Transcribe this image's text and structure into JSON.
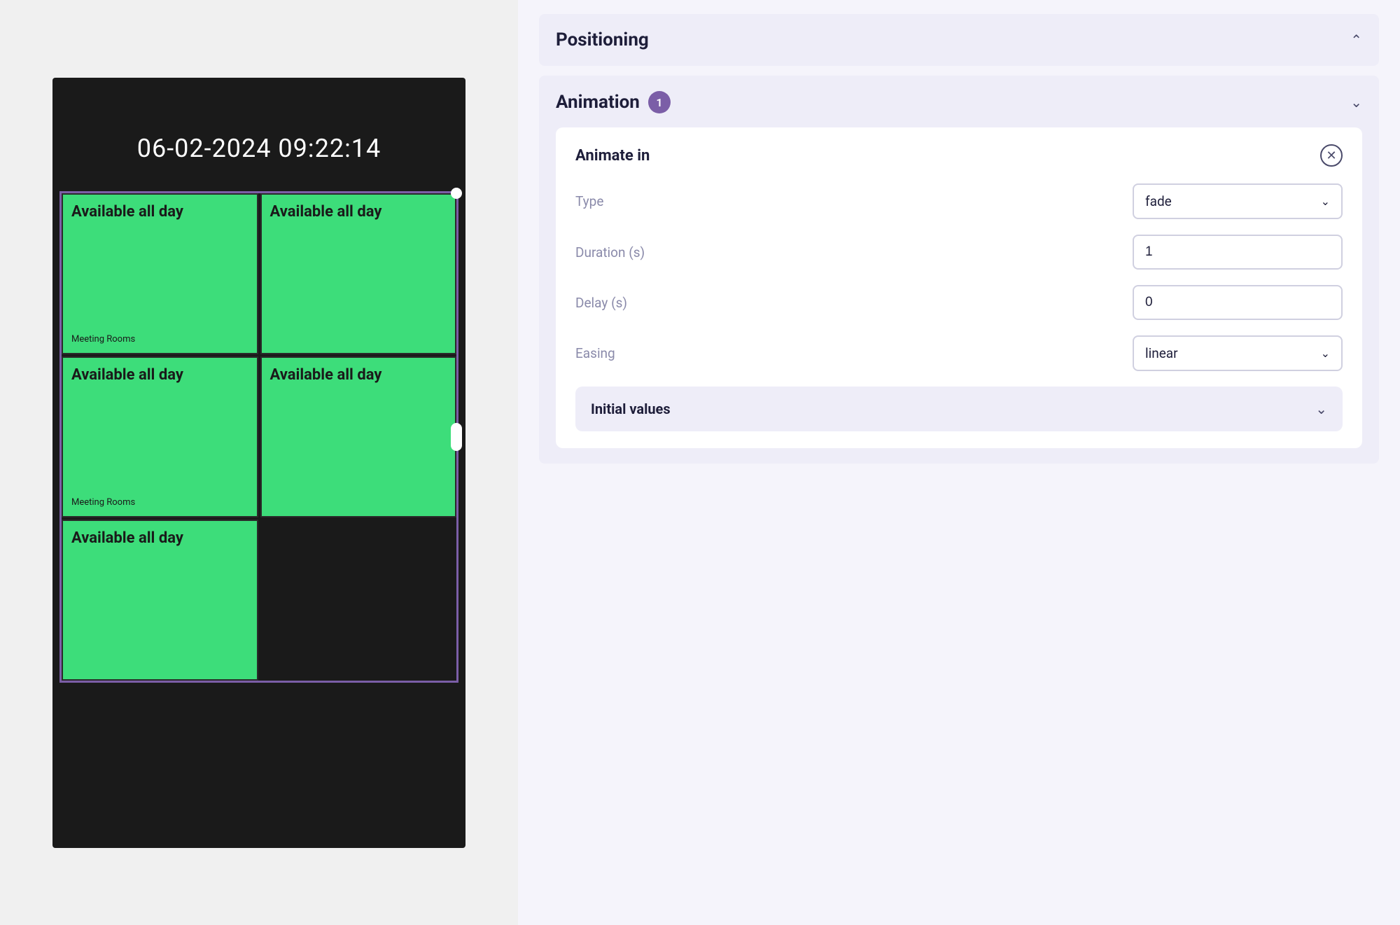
{
  "left": {
    "datetime": "06-02-2024 09:22:14",
    "grid_items": [
      {
        "title": "Available all day",
        "label": "Meeting Rooms"
      },
      {
        "title": "Available all day",
        "label": ""
      },
      {
        "title": "Available all day",
        "label": "Meeting Rooms"
      },
      {
        "title": "Available all day",
        "label": ""
      },
      {
        "title": "Available all day",
        "label": ""
      }
    ]
  },
  "right": {
    "positioning": {
      "title": "Positioning",
      "chevron": "^"
    },
    "animation": {
      "title": "Animation",
      "badge": "1",
      "chevron": "v",
      "animate_in": {
        "title": "Animate in",
        "close_label": "✕",
        "type_label": "Type",
        "type_value": "fade",
        "duration_label": "Duration (s)",
        "duration_value": "1",
        "delay_label": "Delay (s)",
        "delay_value": "0",
        "easing_label": "Easing",
        "easing_value": "linear",
        "initial_values_label": "Initial values",
        "initial_values_chevron": "v"
      }
    }
  }
}
